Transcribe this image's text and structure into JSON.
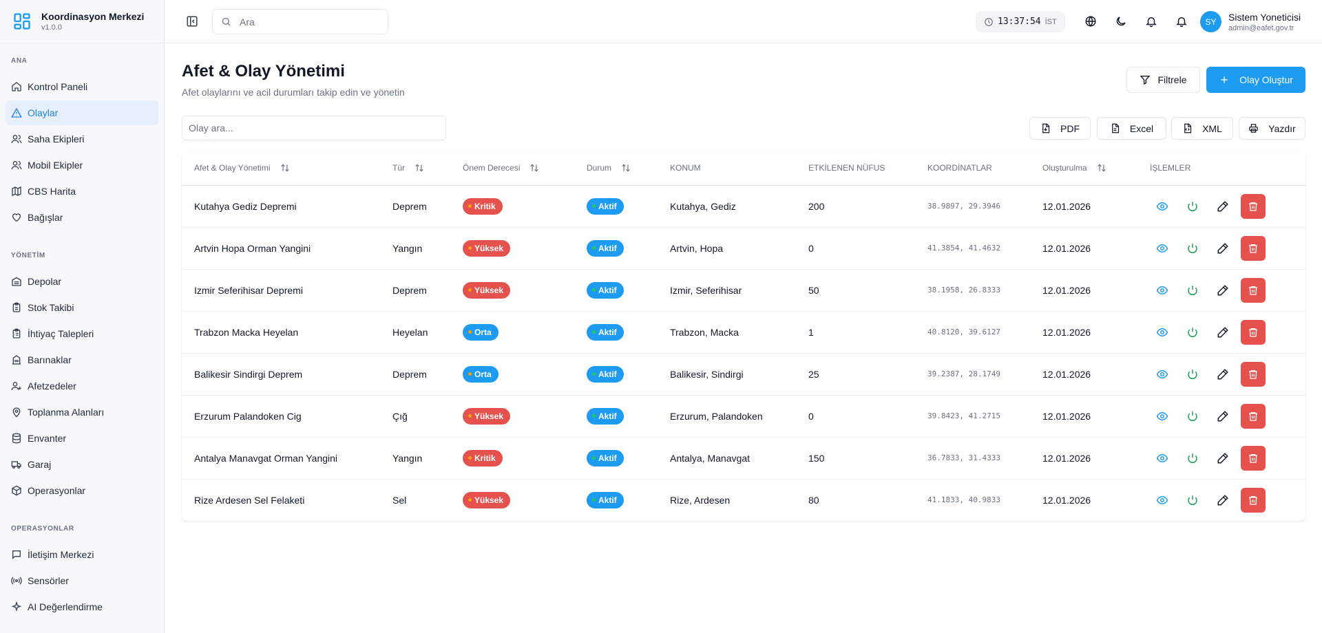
{
  "brand": {
    "title": "Koordinasyon Merkezi",
    "version": "v1.0.0"
  },
  "sidebar": {
    "sections": [
      {
        "title": "ANA",
        "items": [
          {
            "label": "Kontrol Paneli",
            "icon": "home-icon"
          },
          {
            "label": "Olaylar",
            "icon": "alert-triangle-icon",
            "active": true
          },
          {
            "label": "Saha Ekipleri",
            "icon": "users-icon"
          },
          {
            "label": "Mobil Ekipler",
            "icon": "users-icon"
          },
          {
            "label": "CBS Harita",
            "icon": "map-icon"
          },
          {
            "label": "Bağışlar",
            "icon": "heart-icon"
          }
        ]
      },
      {
        "title": "YÖNETİM",
        "items": [
          {
            "label": "Depolar",
            "icon": "warehouse-icon"
          },
          {
            "label": "Stok Takibi",
            "icon": "clipboard-icon"
          },
          {
            "label": "İhtiyaç Talepleri",
            "icon": "clipboard-list-icon"
          },
          {
            "label": "Barınaklar",
            "icon": "building-icon"
          },
          {
            "label": "Afetzedeler",
            "icon": "user-plus-icon"
          },
          {
            "label": "Toplanma Alanları",
            "icon": "map-pin-icon"
          },
          {
            "label": "Envanter",
            "icon": "database-icon"
          },
          {
            "label": "Garaj",
            "icon": "truck-icon"
          },
          {
            "label": "Operasyonlar",
            "icon": "package-icon"
          }
        ]
      },
      {
        "title": "OPERASYONLAR",
        "items": [
          {
            "label": "İletişim Merkezi",
            "icon": "message-square-icon"
          },
          {
            "label": "Sensörler",
            "icon": "radio-icon"
          },
          {
            "label": "AI Değerlendirme",
            "icon": "sparkles-icon"
          }
        ]
      }
    ]
  },
  "header": {
    "search_placeholder": "Ara",
    "time": "13:37:54",
    "timezone": "İST",
    "user": {
      "initials": "SY",
      "name": "Sistem Yoneticisi",
      "email": "admin@eafet.gov.tr"
    }
  },
  "page": {
    "title": "Afet & Olay Yönetimi",
    "subtitle": "Afet olaylarını ve acil durumları takip edin ve yönetin",
    "filter_label": "Filtrele",
    "create_label": "Olay Oluştur",
    "table_search_placeholder": "Olay ara...",
    "export": {
      "pdf": "PDF",
      "excel": "Excel",
      "xml": "XML",
      "print": "Yazdır"
    }
  },
  "table": {
    "columns": {
      "name": "Afet & Olay Yönetimi",
      "type": "Tür",
      "severity": "Önem Derecesi",
      "status": "Durum",
      "location": "KONUM",
      "population": "ETKİLENEN NÜFUS",
      "coordinates": "KOORDİNATLAR",
      "created": "Oluşturulma",
      "actions": "İŞLEMLER"
    },
    "rows": [
      {
        "name": "Kutahya Gediz Depremi",
        "type": "Deprem",
        "severity": "Kritik",
        "status": "Aktif",
        "location": "Kutahya, Gediz",
        "population": "200",
        "coordinates": "38.9897, 29.3946",
        "created": "12.01.2026"
      },
      {
        "name": "Artvin Hopa Orman Yangini",
        "type": "Yangın",
        "severity": "Yüksek",
        "status": "Aktif",
        "location": "Artvin, Hopa",
        "population": "0",
        "coordinates": "41.3854, 41.4632",
        "created": "12.01.2026"
      },
      {
        "name": "Izmir Seferihisar Depremi",
        "type": "Deprem",
        "severity": "Yüksek",
        "status": "Aktif",
        "location": "Izmir, Seferihisar",
        "population": "50",
        "coordinates": "38.1958, 26.8333",
        "created": "12.01.2026"
      },
      {
        "name": "Trabzon Macka Heyelan",
        "type": "Heyelan",
        "severity": "Orta",
        "status": "Aktif",
        "location": "Trabzon, Macka",
        "population": "1",
        "coordinates": "40.8120, 39.6127",
        "created": "12.01.2026"
      },
      {
        "name": "Balikesir Sindirgi Deprem",
        "type": "Deprem",
        "severity": "Orta",
        "status": "Aktif",
        "location": "Balikesir, Sindirgi",
        "population": "25",
        "coordinates": "39.2387, 28.1749",
        "created": "12.01.2026"
      },
      {
        "name": "Erzurum Palandoken Cig",
        "type": "Çığ",
        "severity": "Yüksek",
        "status": "Aktif",
        "location": "Erzurum, Palandoken",
        "population": "0",
        "coordinates": "39.8423, 41.2715",
        "created": "12.01.2026"
      },
      {
        "name": "Antalya Manavgat Orman Yangini",
        "type": "Yangın",
        "severity": "Kritik",
        "status": "Aktif",
        "location": "Antalya, Manavgat",
        "population": "150",
        "coordinates": "36.7833, 31.4333",
        "created": "12.01.2026"
      },
      {
        "name": "Rize Ardesen Sel Felaketi",
        "type": "Sel",
        "severity": "Yüksek",
        "status": "Aktif",
        "location": "Rize, Ardesen",
        "population": "80",
        "coordinates": "41.1833, 40.9833",
        "created": "12.01.2026"
      }
    ]
  },
  "colors": {
    "accent": "#1d9bf0",
    "severity_critical": "#e5524e",
    "severity_high": "#e5524e",
    "severity_medium": "#1d9bf0",
    "status_active": "#1d9bf0",
    "danger": "#e5524e",
    "success": "#22a05b"
  }
}
